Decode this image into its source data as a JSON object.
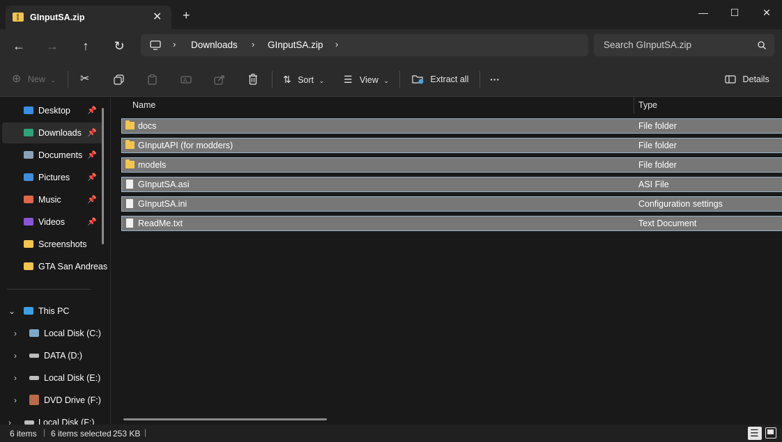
{
  "window": {
    "tab_title": "GInputSA.zip",
    "tab_close": "✕",
    "new_tab": "+",
    "minimize": "—",
    "maximize": "☐",
    "close": "✕"
  },
  "nav": {
    "back": "←",
    "forward": "→",
    "up": "↑",
    "refresh": "↻",
    "breadcrumb": [
      "Downloads",
      "GInputSA.zip"
    ],
    "search_placeholder": "Search GInputSA.zip"
  },
  "toolbar": {
    "new_label": "New",
    "sort_label": "Sort",
    "view_label": "View",
    "extract_label": "Extract all",
    "more_label": "···",
    "details_label": "Details"
  },
  "sidebar": {
    "quick_access": [
      {
        "label": "Desktop",
        "icon": "desktop-icon",
        "color": "#3a8ee6",
        "pinned": true
      },
      {
        "label": "Downloads",
        "icon": "downloads-icon",
        "color": "#2fa37a",
        "pinned": true
      },
      {
        "label": "Documents",
        "icon": "documents-icon",
        "color": "#8aa2b8",
        "pinned": true
      },
      {
        "label": "Pictures",
        "icon": "pictures-icon",
        "color": "#3f8fd8",
        "pinned": true
      },
      {
        "label": "Music",
        "icon": "music-icon",
        "color": "#e0664a",
        "pinned": true
      },
      {
        "label": "Videos",
        "icon": "videos-icon",
        "color": "#8a55d6",
        "pinned": true
      },
      {
        "label": "Screenshots",
        "icon": "folder-icon",
        "color": "#f4c54e",
        "pinned": false
      },
      {
        "label": "GTA San Andreas",
        "icon": "folder-icon",
        "color": "#f4c54e",
        "pinned": false
      }
    ],
    "this_pc": "This PC",
    "drives": [
      {
        "label": "Local Disk (C:)",
        "icon": "system-drive-icon"
      },
      {
        "label": "DATA (D:)",
        "icon": "drive-icon"
      },
      {
        "label": "Local Disk (E:)",
        "icon": "drive-icon"
      },
      {
        "label": "DVD Drive (F:)",
        "icon": "dvd-drive-icon"
      },
      {
        "label": "Local Disk (F:)",
        "icon": "drive-icon"
      }
    ]
  },
  "content": {
    "columns": {
      "name": "Name",
      "type": "Type"
    },
    "files": [
      {
        "name": "docs",
        "type": "File folder",
        "kind": "folder"
      },
      {
        "name": "GInputAPI (for modders)",
        "type": "File folder",
        "kind": "folder"
      },
      {
        "name": "models",
        "type": "File folder",
        "kind": "folder"
      },
      {
        "name": "GInputSA.asi",
        "type": "ASI File",
        "kind": "file"
      },
      {
        "name": "GInputSA.ini",
        "type": "Configuration settings",
        "kind": "file"
      },
      {
        "name": "ReadMe.txt",
        "type": "Text Document",
        "kind": "file"
      }
    ]
  },
  "status": {
    "item_count": "6 items",
    "selected": "6 items selected",
    "size": "253 KB"
  }
}
